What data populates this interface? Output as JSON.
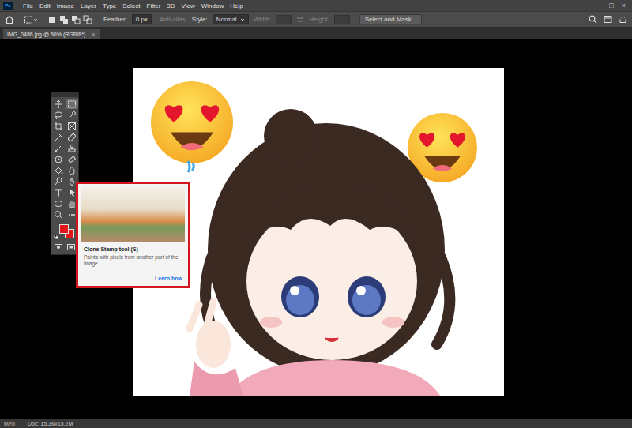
{
  "app": {
    "logo": "Ps"
  },
  "menu": [
    "File",
    "Edit",
    "Image",
    "Layer",
    "Type",
    "Select",
    "Filter",
    "3D",
    "View",
    "Window",
    "Help"
  ],
  "window_controls": [
    "–",
    "□",
    "×"
  ],
  "options_bar": {
    "feather_label": "Feather:",
    "feather_value": "0 px",
    "anti_alias": {
      "label": "Anti-alias",
      "disabled": true
    },
    "style_label": "Style:",
    "style_value": "Normal",
    "width": {
      "label": "Width:",
      "disabled": true
    },
    "height": {
      "label": "Height:",
      "disabled": true
    },
    "select_and_mask": "Select and Mask..."
  },
  "document_tab": {
    "title": "IMG_0486.jpg @ 60% (RGB/8*)",
    "close": "×"
  },
  "toolbox": {
    "tools": [
      {
        "selected": false
      },
      {
        "selected": true
      },
      {
        "selected": false
      },
      {
        "selected": false
      },
      {
        "selected": false
      },
      {
        "selected": false
      },
      {
        "selected": false
      },
      {
        "selected": false
      },
      {
        "selected": false
      },
      {
        "selected": false
      },
      {
        "selected": false
      },
      {
        "selected": false
      },
      {
        "selected": false
      },
      {
        "selected": false
      },
      {
        "selected": false
      },
      {
        "selected": false
      },
      {
        "selected": false
      },
      {
        "selected": false
      },
      {
        "selected": false
      },
      {
        "selected": false
      },
      {
        "selected": false
      },
      {
        "selected": false
      }
    ],
    "foreground_color": "#e3161b",
    "background_color": "#e3161b"
  },
  "tooltip": {
    "title": "Clone Stamp tool (S)",
    "description": "Paints with pixels from another part of the image",
    "link": "Learn how"
  },
  "status_bar": {
    "zoom": "60%",
    "doc_size": "Doc: 15,3M/15,2M"
  }
}
